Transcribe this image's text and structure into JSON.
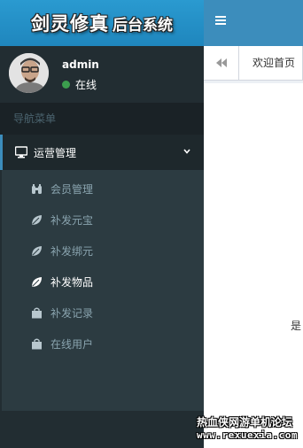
{
  "logo": {
    "main": "剑灵修真",
    "sub": "后台系统"
  },
  "topbar": {
    "toggle_icon": "hamburger-icon"
  },
  "user": {
    "name": "admin",
    "status": "在线",
    "status_color": "#3c9e4e"
  },
  "sidebar": {
    "header": "导航菜单",
    "menu": {
      "label": "运营管理",
      "icon": "desktop-icon",
      "expanded": true,
      "items": [
        {
          "label": "会员管理",
          "icon": "binoculars-icon",
          "active": false
        },
        {
          "label": "补发元宝",
          "icon": "leaf-icon",
          "active": false
        },
        {
          "label": "补发绑元",
          "icon": "leaf-icon",
          "active": false
        },
        {
          "label": "补发物品",
          "icon": "leaf-icon",
          "active": true
        },
        {
          "label": "补发记录",
          "icon": "shopping-bag-icon",
          "active": false
        },
        {
          "label": "在线用户",
          "icon": "shopping-bag-icon",
          "active": false
        }
      ]
    }
  },
  "tabs": {
    "prev_icon": "backward-icon",
    "home": "欢迎首页"
  },
  "content": {
    "text": "是"
  },
  "watermark": {
    "line1": "热血侠网游单机论坛",
    "line2": "www.rexuexia.com"
  },
  "colors": {
    "logo_bg": "#2a9ad0",
    "topbar_bg": "#3c8dbc",
    "sidebar_bg": "#222d32",
    "submenu_bg": "#2c3b41"
  }
}
